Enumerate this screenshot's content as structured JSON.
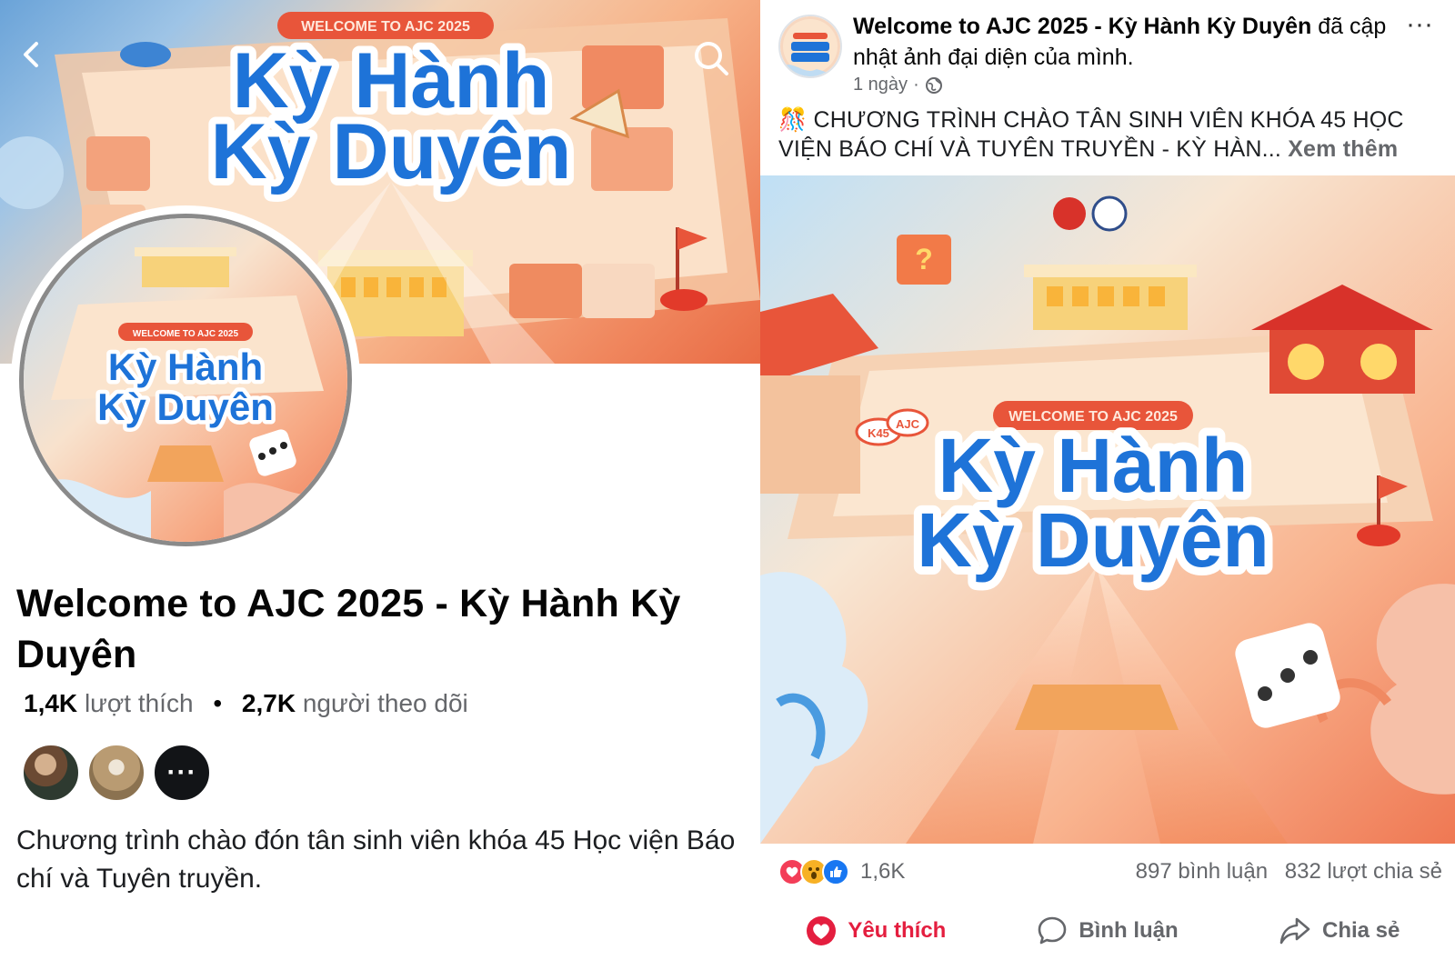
{
  "profile": {
    "name": "Welcome to AJC 2025 - Kỳ Hành Kỳ Duyên",
    "likes_count": "1,4K",
    "likes_label": "lượt thích",
    "followers_count": "2,7K",
    "followers_label": "người theo dõi",
    "stats_separator": "•",
    "friends_more": "···",
    "about": "Chương trình chào đón tân sinh viên khóa 45 Học viện Báo chí và Tuyên truyền."
  },
  "artwork": {
    "banner": "WELCOME TO AJC 2025",
    "title_line1": "Kỳ Hành",
    "title_line2": "Kỳ Duyên",
    "badge_k45": "K45",
    "badge_ajc": "AJC"
  },
  "post": {
    "author": "Welcome to AJC 2025 - Kỳ Hành Kỳ Duyên",
    "action_text": "đã cập nhật ảnh đại diện của mình.",
    "time": "1 ngày",
    "body": "🎊 CHƯƠNG TRÌNH CHÀO TÂN SINH VIÊN KHÓA 45 HỌC VIỆN BÁO CHÍ VÀ TUYÊN TRUYỀN - KỲ HÀN...",
    "see_more": "Xem thêm",
    "reaction_count": "1,6K",
    "comments": "897 bình luận",
    "shares": "832 lượt chia sẻ",
    "more_glyph": "···"
  },
  "actions": {
    "like": "Yêu thích",
    "comment": "Bình luận",
    "share": "Chia sẻ"
  },
  "icons": {
    "back": "chevron-left-icon",
    "search": "search-icon",
    "globe": "globe-icon",
    "love": "heart-icon",
    "wow": "wow-icon",
    "like": "thumbs-up-icon",
    "comment": "comment-icon",
    "share": "share-icon"
  },
  "colors": {
    "title_blue": "#1e73d8",
    "banner_red": "#e8553a",
    "love_red": "#e41e3f",
    "like_blue": "#1877f2",
    "secondary_text": "#65676b"
  }
}
